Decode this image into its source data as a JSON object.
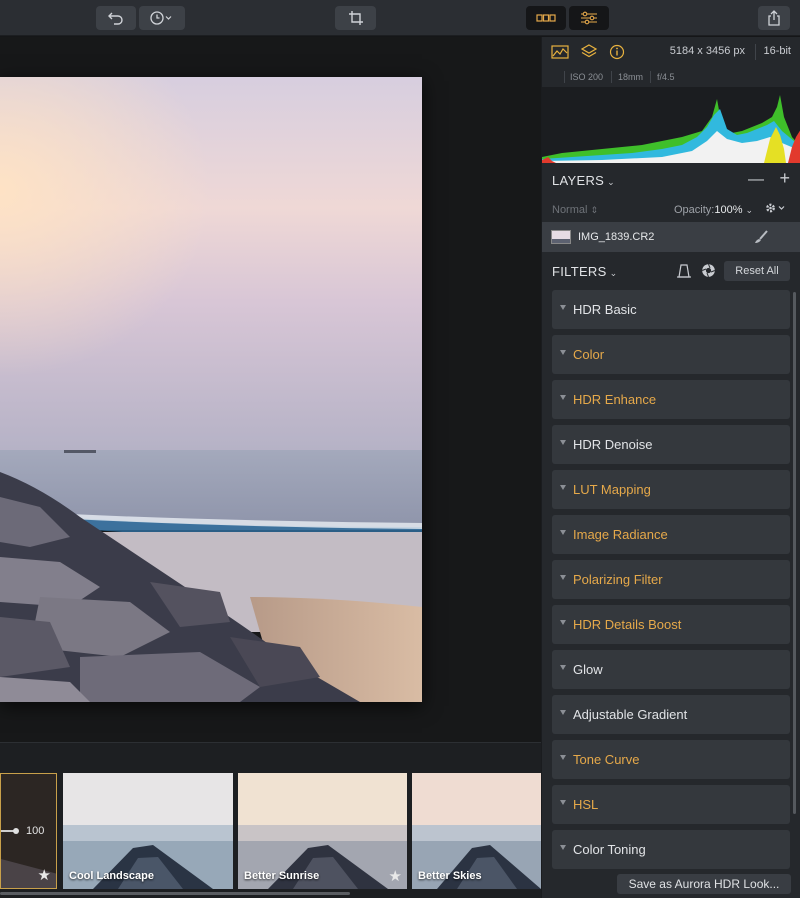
{
  "image_info": {
    "dimensions": "5184 x 3456 px",
    "bit_depth": "16-bit",
    "iso": "ISO 200",
    "focal_length": "18mm",
    "aperture": "f/4.5"
  },
  "layers": {
    "title": "LAYERS",
    "blend_mode": "Normal",
    "opacity_label": "Opacity:",
    "opacity_value": "100%",
    "items": [
      {
        "name": "IMG_1839.CR2"
      }
    ]
  },
  "filters": {
    "title": "FILTERS",
    "reset_label": "Reset All",
    "items": [
      {
        "name": "HDR Basic",
        "active": false
      },
      {
        "name": "Color",
        "active": true
      },
      {
        "name": "HDR Enhance",
        "active": true
      },
      {
        "name": "HDR Denoise",
        "active": false
      },
      {
        "name": "LUT Mapping",
        "active": true
      },
      {
        "name": "Image Radiance",
        "active": true
      },
      {
        "name": "Polarizing Filter",
        "active": true
      },
      {
        "name": "HDR Details Boost",
        "active": true
      },
      {
        "name": "Glow",
        "active": false
      },
      {
        "name": "Adjustable Gradient",
        "active": false
      },
      {
        "name": "Tone Curve",
        "active": true
      },
      {
        "name": "HSL",
        "active": true
      },
      {
        "name": "Color Toning",
        "active": false
      }
    ],
    "save_look_label": "Save as Aurora HDR Look..."
  },
  "filmstrip": {
    "selected_amount": "100",
    "looks": [
      {
        "name": "Cool Landscape",
        "starred": false
      },
      {
        "name": "Better Sunrise",
        "starred": true
      },
      {
        "name": "Better Skies",
        "starred": false
      }
    ]
  },
  "colors": {
    "accent": "#e6a94a",
    "panel": "#25282c",
    "toolbar": "#2b2e33"
  }
}
